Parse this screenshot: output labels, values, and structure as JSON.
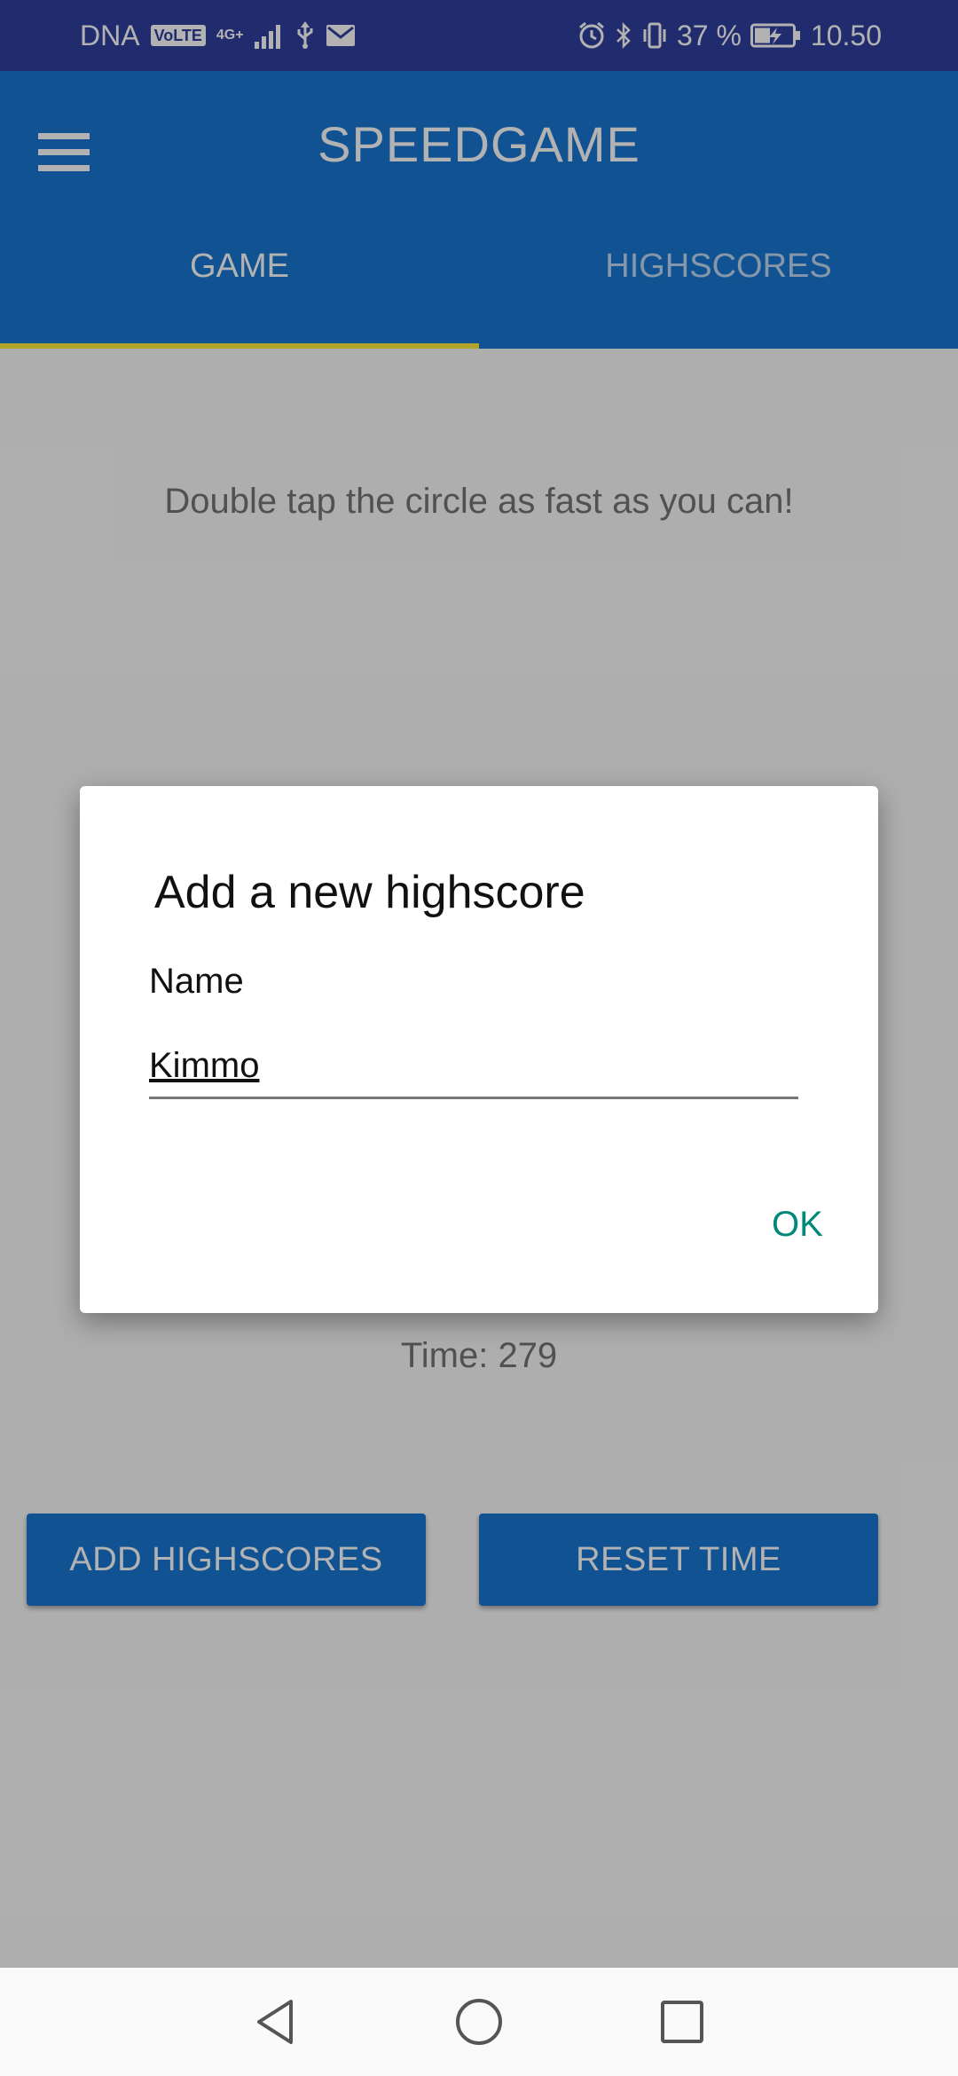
{
  "status_bar": {
    "carrier": "DNA",
    "volte": "VoLTE",
    "network_type": "4G+",
    "battery_percent": "37 %",
    "time": "10.50",
    "icons": [
      "signal-icon",
      "usb-icon",
      "mail-icon",
      "alarm-icon",
      "bluetooth-icon",
      "vibrate-icon",
      "battery-charging-icon"
    ]
  },
  "app_bar": {
    "title": "SPEEDGAME",
    "menu_icon": "hamburger-menu-icon",
    "tabs": [
      {
        "label": "GAME",
        "selected": true
      },
      {
        "label": "HIGHSCORES",
        "selected": false
      }
    ]
  },
  "game": {
    "instruction": "Double tap the circle as fast as you can!",
    "time_text": "Time: 279",
    "buttons": {
      "add_highscores": "ADD HIGHSCORES",
      "reset_time": "RESET TIME"
    }
  },
  "dialog": {
    "title": "Add a new highscore",
    "field_label": "Name",
    "name_value": "Kimmo",
    "ok_label": "OK"
  },
  "colors": {
    "status_bar": "#303f9f",
    "primary": "#1976d2",
    "tab_indicator": "#ffeb3b",
    "dialog_button": "#00897b"
  },
  "nav_bar": {
    "icons": [
      "back-triangle-icon",
      "home-circle-icon",
      "recents-square-icon"
    ]
  }
}
